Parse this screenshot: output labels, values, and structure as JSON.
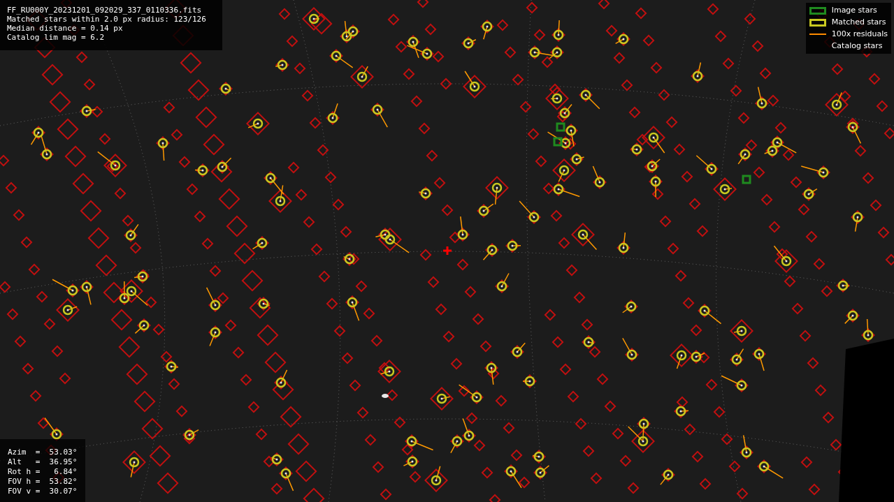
{
  "info_panel": {
    "lines": [
      "FF_RU000Y_20231201_092029_337_0110336.fits",
      "Matched stars within 2.0 px radius: 123/126",
      "Median distance = 0.14 px",
      "Catalog lim mag = 6.2"
    ]
  },
  "legend": {
    "items": [
      {
        "kind": "box",
        "color": "#1f8a1f",
        "label": "Image stars"
      },
      {
        "kind": "box",
        "color": "#c8c820",
        "label": "Matched stars"
      },
      {
        "kind": "line",
        "color": "#ff8c00",
        "label": "100x residuals"
      },
      {
        "kind": "none",
        "label": "Catalog stars"
      }
    ]
  },
  "pointing_panel": {
    "lines": [
      "Azim  =  53.03°",
      "Alt   =  36.95°",
      "Rot h =   6.84°",
      "FOV h =  53.82°",
      "FOV v =  30.07°"
    ]
  }
}
